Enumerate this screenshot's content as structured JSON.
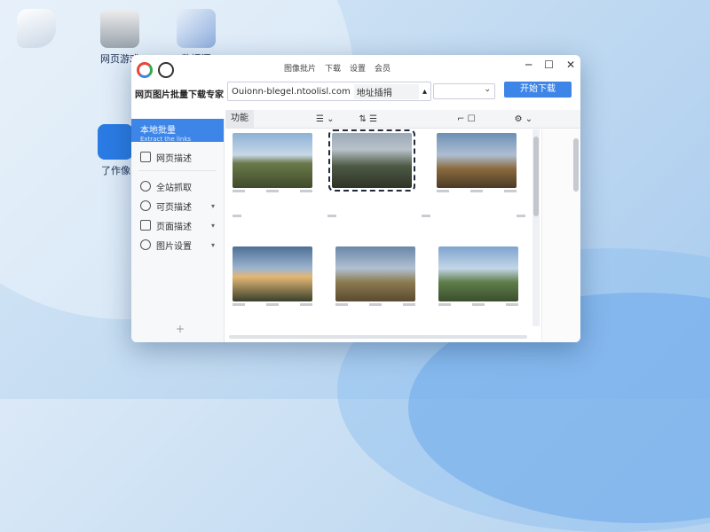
{
  "desktop": {
    "icons": [
      {
        "label": "网页游戏"
      },
      {
        "label": "数据源"
      },
      {
        "label": "了作像"
      }
    ]
  },
  "window": {
    "menu": [
      "图像批片",
      "下载",
      "设置",
      "会员"
    ],
    "app_title": "网页图片批量下载专家",
    "url_value": "Ouionn-blegel.ntoolisl.com",
    "address_placeholder": "地址插捐",
    "start_button": "开始下载",
    "toolbar_label": "功能",
    "sidebar": {
      "items": [
        {
          "label": "本地批量",
          "sub": "Extract the links"
        },
        {
          "label": "网页描述"
        },
        {
          "label": "全站抓取"
        },
        {
          "label": "可页描述"
        },
        {
          "label": "页面描述"
        },
        {
          "label": "图片设置"
        }
      ]
    }
  },
  "colors": {
    "accent": "#3d86e8",
    "titlebar_bg": "#ffffff",
    "sidebar_bg": "#f7f8fa"
  }
}
